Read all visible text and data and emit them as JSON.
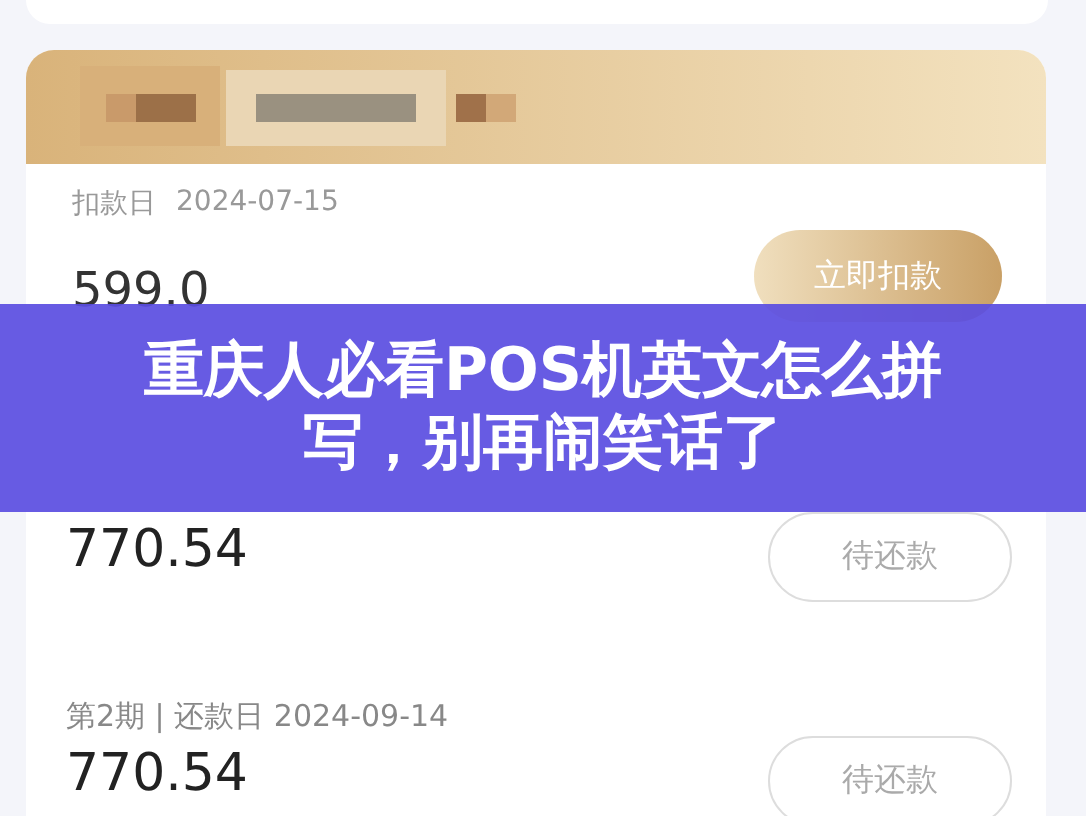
{
  "bill": {
    "deduct_label": "扣款日",
    "deduct_date": "2024-07-15",
    "amount": "599.0",
    "action": "立即扣款"
  },
  "installments": [
    {
      "amount": "770.54",
      "status": "待还款"
    },
    {
      "label": "第2期 | 还款日 2024-09-14",
      "amount": "770.54",
      "status": "待还款"
    }
  ],
  "banner": {
    "title": "重庆人必看POS机英文怎么拼写，别再闹笑话了"
  }
}
